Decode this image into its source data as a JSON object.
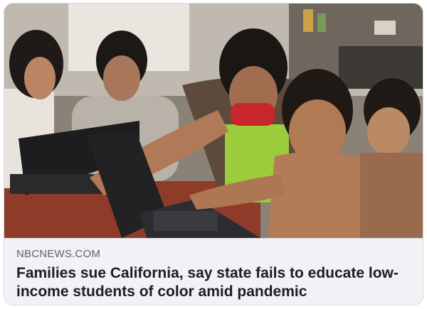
{
  "link_preview": {
    "image_alt": "Family with children using laptops at a kitchen table",
    "domain": "NBCNEWS.COM",
    "headline": "Families sue California, say state fails to educate low-income students of color amid pandemic",
    "colors": {
      "meta_background": "#f0f2f5",
      "headline": "#1c1e21",
      "domain": "#5f6368"
    }
  }
}
